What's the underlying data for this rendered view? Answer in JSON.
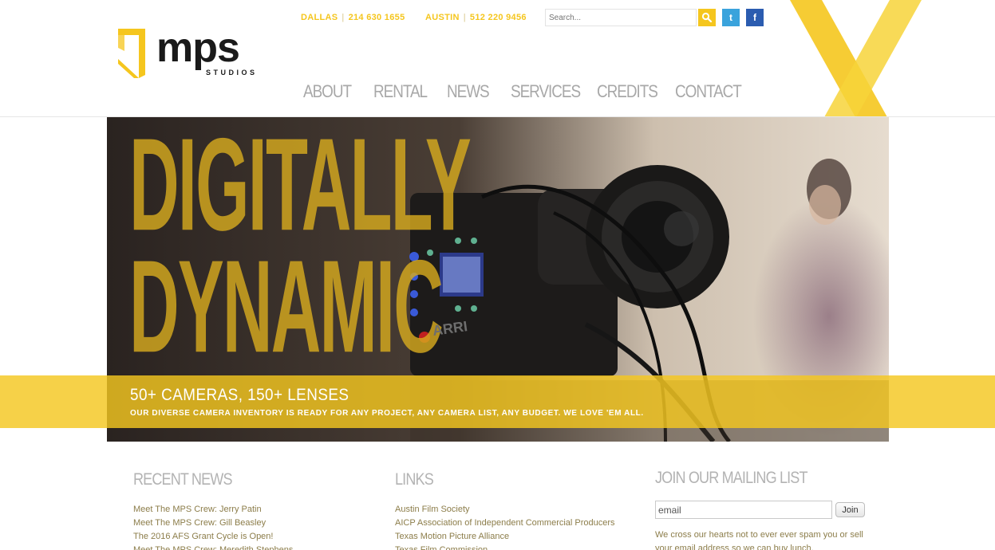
{
  "brand": {
    "logo_word": "mps",
    "logo_sub": "STUDIOS",
    "accent_color": "#f5c61e"
  },
  "contacts": {
    "dallas_label": "DALLAS",
    "dallas_phone": "214 630 1655",
    "austin_label": "AUSTIN",
    "austin_phone": "512 220 9456"
  },
  "search": {
    "placeholder": "Search...",
    "button_icon": "search-icon"
  },
  "social": {
    "twitter_icon": "twitter-icon",
    "facebook_icon": "facebook-icon"
  },
  "nav": {
    "items": [
      "ABOUT",
      "RENTAL",
      "NEWS",
      "SERVICES",
      "CREDITS",
      "CONTACT"
    ]
  },
  "hero": {
    "headline_line1": "DIGITALLY",
    "headline_line2": "DYNAMIC",
    "band_title": "50+ CAMERAS, 150+ LENSES",
    "band_subtitle": "OUR DIVERSE CAMERA INVENTORY IS READY FOR ANY PROJECT, ANY CAMERA LIST, ANY BUDGET. WE LOVE 'EM ALL.",
    "camera_brand": "ARRI"
  },
  "recent_news": {
    "heading": "RECENT NEWS",
    "items": [
      "Meet The MPS Crew: Jerry Patin",
      "Meet The MPS Crew: Gill Beasley",
      "The 2016 AFS Grant Cycle is Open!",
      "Meet The MPS Crew: Meredith Stephens"
    ]
  },
  "links": {
    "heading": "LINKS",
    "items": [
      "Austin Film Society",
      "AICP Association of Independent Commercial Producers",
      "Texas Motion Picture Alliance",
      "Texas Film Commission"
    ]
  },
  "mailing": {
    "heading": "JOIN OUR MAILING LIST",
    "email_value": "email",
    "join_label": "Join",
    "note": "We cross our hearts not to ever ever spam you or sell your email address so we can buy lunch."
  }
}
